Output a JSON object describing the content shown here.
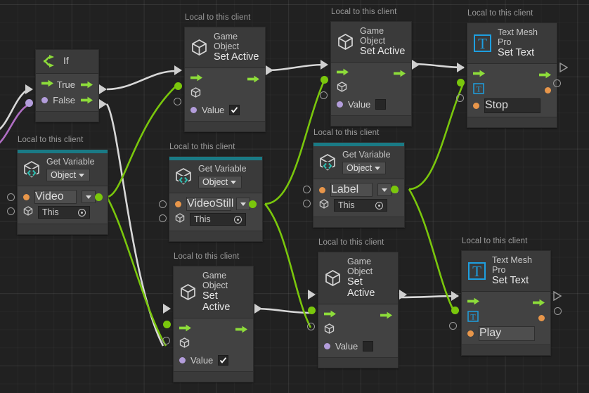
{
  "app": {
    "title": "Unity Visual Scripting Graph"
  },
  "canvas": {
    "background": "#212121",
    "grid_minor": "#262626",
    "grid_major": "#2c2c2c",
    "flow_wire_color": "#d8d8d8",
    "data_wire_color": "#7ac70c",
    "event_wire_color": "#b06ec4"
  },
  "common": {
    "scope_label": "Local to this client",
    "variable_kind": "Object",
    "this_value": "This",
    "value_label": "Value"
  },
  "nodes": [
    {
      "id": "if",
      "kind": "if",
      "title": "If",
      "icon": "branch-icon",
      "ports": [
        {
          "label": "True",
          "in_icon": "flow-arrow",
          "out_icon": "flow-arrow"
        },
        {
          "label": "False",
          "in_icon": "bool-dot",
          "out_icon": "flow-arrow"
        }
      ]
    },
    {
      "id": "get-var-video",
      "kind": "get-variable",
      "scope": "Local to this client",
      "title_line1": "Get Variable",
      "icon": "variable-object-icon",
      "kind_dropdown": "Object",
      "variable_name": "Video",
      "source": "This"
    },
    {
      "id": "get-var-videostill",
      "kind": "get-variable",
      "scope": "Local to this client",
      "title_line1": "Get Variable",
      "icon": "variable-object-icon",
      "kind_dropdown": "Object",
      "variable_name": "VideoStill",
      "source": "This"
    },
    {
      "id": "get-var-label",
      "kind": "get-variable",
      "scope": "Local to this client",
      "title_line1": "Get Variable",
      "icon": "variable-object-icon",
      "kind_dropdown": "Object",
      "variable_name": "Label",
      "source": "This"
    },
    {
      "id": "setactive-1",
      "kind": "set-active",
      "scope": "Local to this client",
      "title_line1": "Game Object",
      "title_line2": "Set Active",
      "icon": "gameobject-cube-icon",
      "value_label": "Value",
      "value_checked": true
    },
    {
      "id": "setactive-2",
      "kind": "set-active",
      "scope": "Local to this client",
      "title_line1": "Game Object",
      "title_line2": "Set Active",
      "icon": "gameobject-cube-icon",
      "value_label": "Value",
      "value_checked": false
    },
    {
      "id": "setactive-3",
      "kind": "set-active",
      "scope": "Local to this client",
      "title_line1": "Game Object",
      "title_line2": "Set Active",
      "icon": "gameobject-cube-icon",
      "value_label": "Value",
      "value_checked": true
    },
    {
      "id": "setactive-4",
      "kind": "set-active",
      "scope": "Local to this client",
      "title_line1": "Game Object",
      "title_line2": "Set Active",
      "icon": "gameobject-cube-icon",
      "value_label": "Value",
      "value_checked": false
    },
    {
      "id": "settext-1",
      "kind": "set-text",
      "scope": "Local to this client",
      "title_line1": "Text Mesh Pro",
      "title_line2": "Set Text",
      "icon": "textmeshpro-icon",
      "text_value": "Stop"
    },
    {
      "id": "settext-2",
      "kind": "set-text",
      "scope": "Local to this client",
      "title_line1": "Text Mesh Pro",
      "title_line2": "Set Text",
      "icon": "textmeshpro-icon",
      "text_value": "Play"
    }
  ]
}
